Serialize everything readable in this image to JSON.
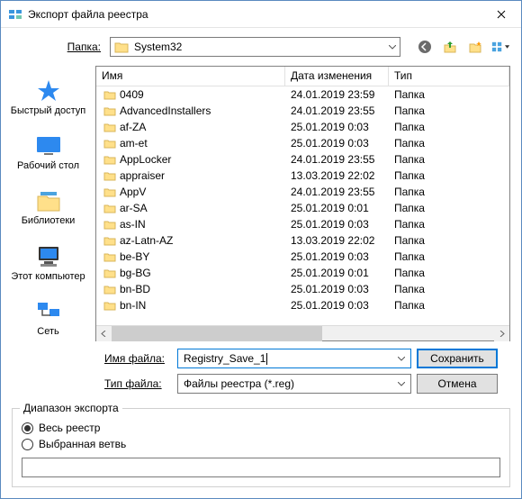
{
  "title": "Экспорт файла реестра",
  "folder": {
    "label": "Папка:",
    "value": "System32"
  },
  "headers": {
    "name": "Имя",
    "date": "Дата изменения",
    "type": "Тип"
  },
  "rows": [
    {
      "name": "0409",
      "date": "24.01.2019 23:59",
      "type": "Папка"
    },
    {
      "name": "AdvancedInstallers",
      "date": "24.01.2019 23:55",
      "type": "Папка"
    },
    {
      "name": "af-ZA",
      "date": "25.01.2019 0:03",
      "type": "Папка"
    },
    {
      "name": "am-et",
      "date": "25.01.2019 0:03",
      "type": "Папка"
    },
    {
      "name": "AppLocker",
      "date": "24.01.2019 23:55",
      "type": "Папка"
    },
    {
      "name": "appraiser",
      "date": "13.03.2019 22:02",
      "type": "Папка"
    },
    {
      "name": "AppV",
      "date": "24.01.2019 23:55",
      "type": "Папка"
    },
    {
      "name": "ar-SA",
      "date": "25.01.2019 0:01",
      "type": "Папка"
    },
    {
      "name": "as-IN",
      "date": "25.01.2019 0:03",
      "type": "Папка"
    },
    {
      "name": "az-Latn-AZ",
      "date": "13.03.2019 22:02",
      "type": "Папка"
    },
    {
      "name": "be-BY",
      "date": "25.01.2019 0:03",
      "type": "Папка"
    },
    {
      "name": "bg-BG",
      "date": "25.01.2019 0:01",
      "type": "Папка"
    },
    {
      "name": "bn-BD",
      "date": "25.01.2019 0:03",
      "type": "Папка"
    },
    {
      "name": "bn-IN",
      "date": "25.01.2019 0:03",
      "type": "Папка"
    }
  ],
  "places": {
    "quick": "Быстрый доступ",
    "desktop": "Рабочий стол",
    "libraries": "Библиотеки",
    "thispc": "Этот компьютер",
    "network": "Сеть"
  },
  "form": {
    "filename_label": "Имя файла:",
    "filename_value": "Registry_Save_1",
    "filetype_label": "Тип файла:",
    "filetype_value": "Файлы реестра (*.reg)",
    "save": "Сохранить",
    "cancel": "Отмена"
  },
  "export": {
    "legend": "Диапазон экспорта",
    "all": "Весь реестр",
    "branch": "Выбранная ветвь"
  }
}
